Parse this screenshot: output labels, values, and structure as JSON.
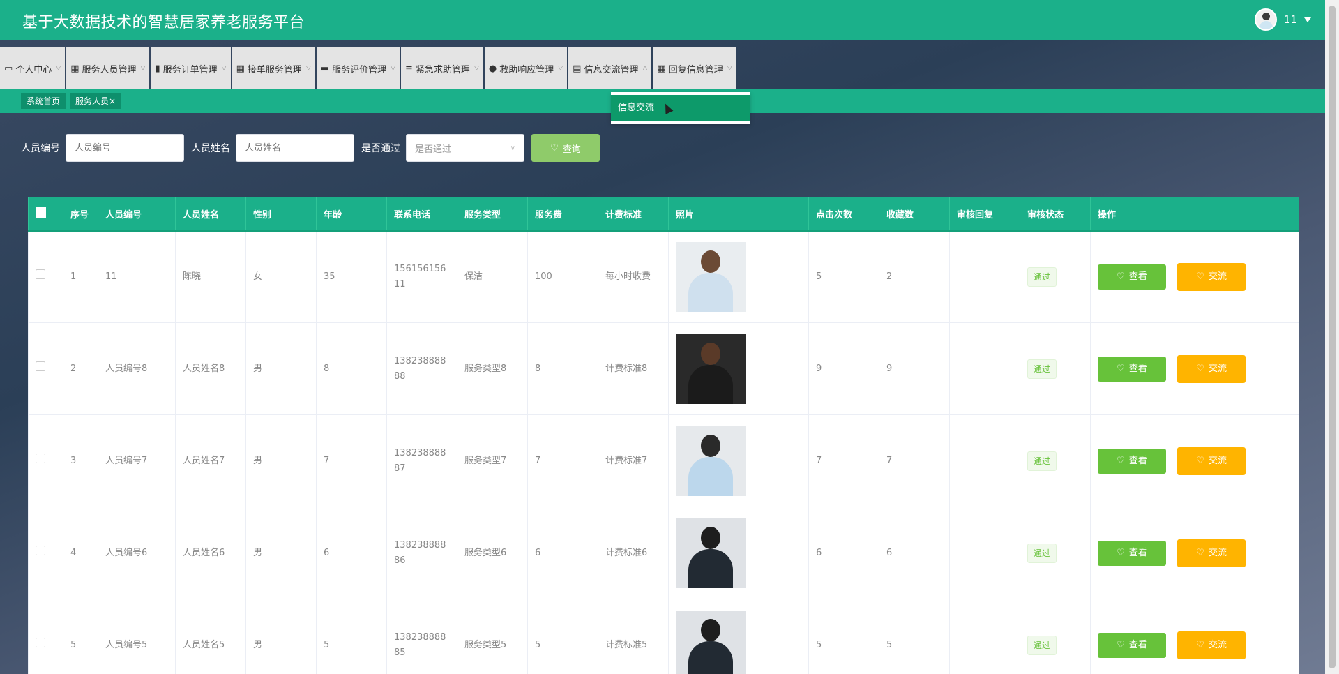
{
  "header": {
    "title": "基于大数据技术的智慧居家养老服务平台",
    "username": "11"
  },
  "nav": [
    {
      "label": "个人中心",
      "icon": "▭"
    },
    {
      "label": "服务人员管理",
      "icon": "▦"
    },
    {
      "label": "服务订单管理",
      "icon": "▮"
    },
    {
      "label": "接单服务管理",
      "icon": "▦"
    },
    {
      "label": "服务评价管理",
      "icon": "▬"
    },
    {
      "label": "紧急求助管理",
      "icon": "≡"
    },
    {
      "label": "救助响应管理",
      "icon": "●"
    },
    {
      "label": "信息交流管理",
      "icon": "▤"
    },
    {
      "label": "回复信息管理",
      "icon": "▦"
    }
  ],
  "dropdown": {
    "option": "信息交流"
  },
  "tags": {
    "home": "系统首页",
    "current": "服务人员",
    "close": "×"
  },
  "search": {
    "id_label": "人员编号",
    "id_placeholder": "人员编号",
    "name_label": "人员姓名",
    "name_placeholder": "人员姓名",
    "pass_label": "是否通过",
    "pass_placeholder": "是否通过",
    "query_label": "查询"
  },
  "table": {
    "headers": [
      "序号",
      "人员编号",
      "人员姓名",
      "性别",
      "年龄",
      "联系电话",
      "服务类型",
      "服务费",
      "计费标准",
      "照片",
      "点击次数",
      "收藏数",
      "审核回复",
      "审核状态",
      "操作"
    ],
    "rows": [
      {
        "no": "1",
        "id": "11",
        "name": "陈晓",
        "gender": "女",
        "age": "35",
        "phone1": "156156156",
        "phone2": "11",
        "type": "保洁",
        "fee": "100",
        "std": "每小时收费",
        "clicks": "5",
        "favs": "2",
        "reply": "",
        "status": "通过"
      },
      {
        "no": "2",
        "id": "人员编号8",
        "name": "人员姓名8",
        "gender": "男",
        "age": "8",
        "phone1": "138238888",
        "phone2": "88",
        "type": "服务类型8",
        "fee": "8",
        "std": "计费标准8",
        "clicks": "9",
        "favs": "9",
        "reply": "",
        "status": "通过"
      },
      {
        "no": "3",
        "id": "人员编号7",
        "name": "人员姓名7",
        "gender": "男",
        "age": "7",
        "phone1": "138238888",
        "phone2": "87",
        "type": "服务类型7",
        "fee": "7",
        "std": "计费标准7",
        "clicks": "7",
        "favs": "7",
        "reply": "",
        "status": "通过"
      },
      {
        "no": "4",
        "id": "人员编号6",
        "name": "人员姓名6",
        "gender": "男",
        "age": "6",
        "phone1": "138238888",
        "phone2": "86",
        "type": "服务类型6",
        "fee": "6",
        "std": "计费标准6",
        "clicks": "6",
        "favs": "6",
        "reply": "",
        "status": "通过"
      },
      {
        "no": "5",
        "id": "人员编号5",
        "name": "人员姓名5",
        "gender": "男",
        "age": "5",
        "phone1": "138238888",
        "phone2": "85",
        "type": "服务类型5",
        "fee": "5",
        "std": "计费标准5",
        "clicks": "5",
        "favs": "5",
        "reply": "",
        "status": "通过"
      }
    ],
    "view_label": "查看",
    "chat_label": "交流"
  },
  "colors": {
    "primary": "#1bb08a",
    "view": "#67c23a",
    "chat": "#ffb400",
    "query": "#8fcb6a"
  }
}
